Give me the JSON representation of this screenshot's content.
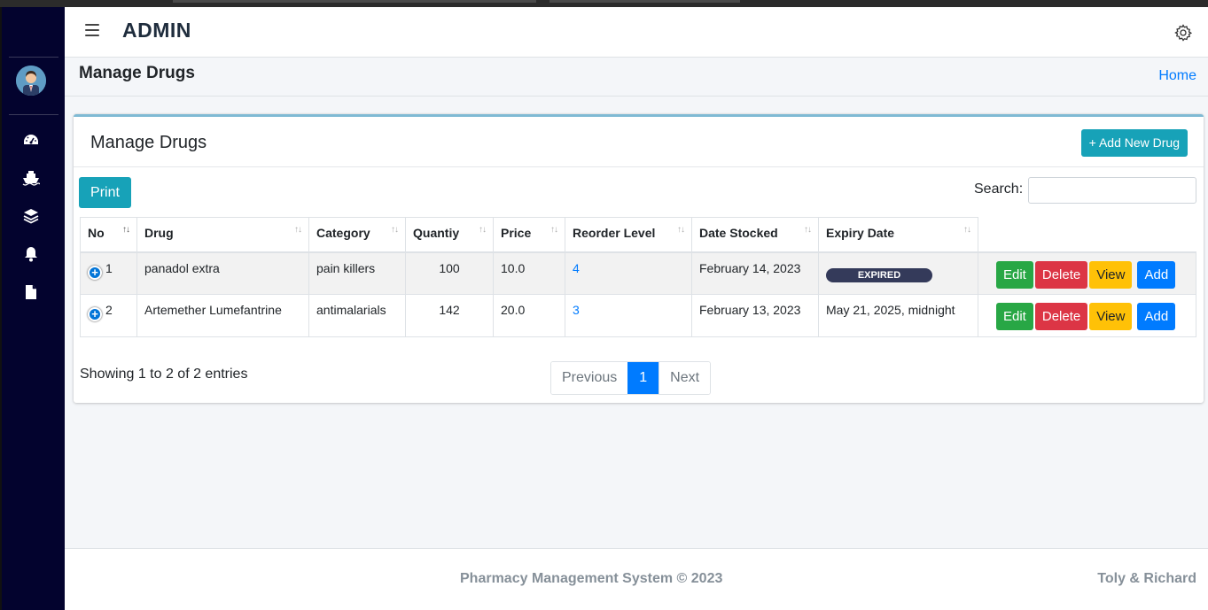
{
  "navbar": {
    "brand": "ADMIN"
  },
  "sidebar": {
    "items": [
      {
        "icon": "tachometer-icon"
      },
      {
        "icon": "ship-icon"
      },
      {
        "icon": "layers-icon"
      },
      {
        "icon": "bell-icon"
      },
      {
        "icon": "file-icon"
      }
    ]
  },
  "header": {
    "title": "Manage Drugs",
    "breadcrumb_home": "Home"
  },
  "card": {
    "title": "Manage Drugs",
    "add_new_label": "+ Add New Drug",
    "print_label": "Print",
    "search_label": "Search:",
    "search_value": ""
  },
  "table": {
    "columns": [
      "No",
      "Drug",
      "Category",
      "Quantiy",
      "Price",
      "Reorder Level",
      "Date Stocked",
      "Expiry Date"
    ],
    "rows": [
      {
        "no": "1",
        "drug": "panadol extra",
        "category": "pain killers",
        "quantity": "100",
        "price": "10.0",
        "reorder_level": "4",
        "date_stocked": "February 14, 2023",
        "expiry_date": "EXPIRED",
        "expiry_is_badge": true
      },
      {
        "no": "2",
        "drug": "Artemether Lumefantrine",
        "category": "antimalarials",
        "quantity": "142",
        "price": "20.0",
        "reorder_level": "3",
        "date_stocked": "February 13, 2023",
        "expiry_date": "May 21, 2025, midnight",
        "expiry_is_badge": false
      }
    ],
    "actions": {
      "edit": "Edit",
      "delete": "Delete",
      "view": "View",
      "add": "Add"
    }
  },
  "pagination": {
    "info": "Showing 1 to 2 of 2 entries",
    "previous": "Previous",
    "current_page": "1",
    "next": "Next"
  },
  "footer": {
    "copyright": "Pharmacy Management System © 2023",
    "authors": "Toly & Richard"
  },
  "colors": {
    "sidebar": "#03032e",
    "primary": "#007bff",
    "info": "#17a2b8",
    "success": "#28a745",
    "danger": "#dc3545",
    "warning": "#ffc107"
  }
}
